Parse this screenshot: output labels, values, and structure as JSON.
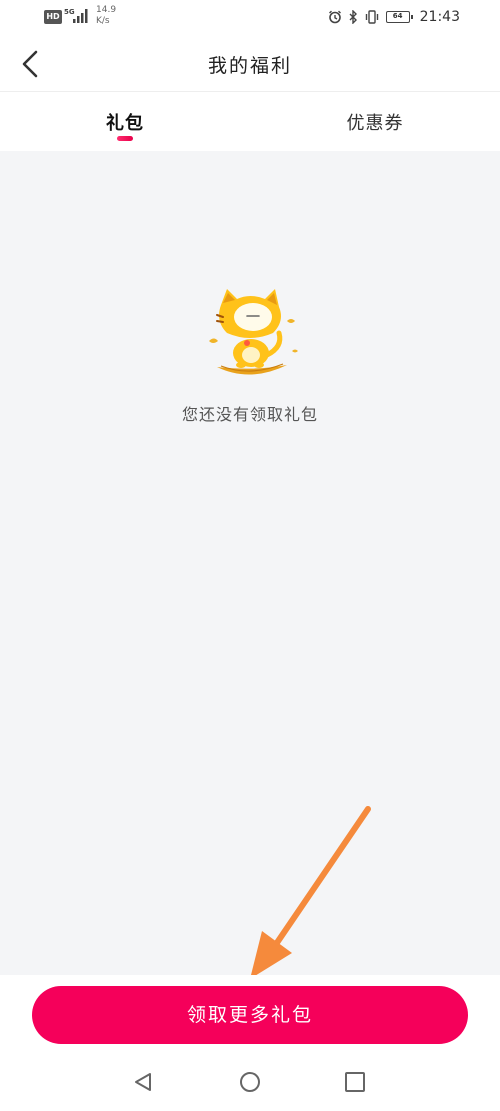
{
  "status_bar": {
    "hd": "HD",
    "network": "5G",
    "speed_value": "14.9",
    "speed_unit": "K/s",
    "battery": "64",
    "time": "21:43"
  },
  "header": {
    "title": "我的福利"
  },
  "tabs": [
    {
      "label": "礼包",
      "active": true
    },
    {
      "label": "优惠券",
      "active": false
    }
  ],
  "empty_state": {
    "message": "您还没有领取礼包"
  },
  "actions": {
    "claim_label": "领取更多礼包"
  },
  "colors": {
    "accent": "#f5005a",
    "arrow": "#f58a3c",
    "content_bg": "#f4f5f7",
    "mascot": "#ffc21a"
  },
  "icons": [
    "back-arrow-icon",
    "alarm-icon",
    "bluetooth-icon",
    "vibrate-icon",
    "battery-icon",
    "nav-back-icon",
    "nav-home-icon",
    "nav-recent-icon"
  ]
}
